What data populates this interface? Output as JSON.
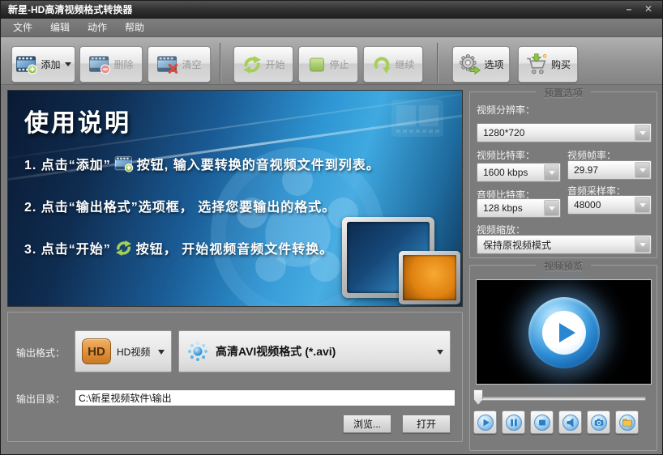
{
  "titlebar": {
    "title": "新星-HD高清视频格式转换器",
    "minimize_icon": "–",
    "close_icon": "✕"
  },
  "menubar": {
    "items": [
      "文件",
      "编辑",
      "动作",
      "帮助"
    ]
  },
  "toolbar": {
    "add": "添加",
    "delete": "删除",
    "clear": "清空",
    "start": "开始",
    "stop": "停止",
    "resume": "继续",
    "options": "选项",
    "buy": "购买"
  },
  "instructions": {
    "title": "使用说明",
    "line1_pre": "1. 点击“添加”",
    "line1_post": "按钮, 输入要转换的音视频文件到列表。",
    "line2": "2. 点击“输出格式”选项框， 选择您要输出的格式。",
    "line3_pre": "3. 点击“开始”",
    "line3_post": "按钮， 开始视频音频文件转换。"
  },
  "presets": {
    "header": "预置选项",
    "resolution_label": "视频分辨率：",
    "resolution_value": "1280*720",
    "video_bitrate_label": "视频比特率：",
    "video_bitrate_value": "1600 kbps",
    "framerate_label": "视频帧率：",
    "framerate_value": "29.97",
    "audio_bitrate_label": "音频比特率：",
    "audio_bitrate_value": "128 kbps",
    "sample_rate_label": "音频采样率：",
    "sample_rate_value": "48000",
    "scale_label": "视频缩放：",
    "scale_value": "保持原视频模式"
  },
  "preview": {
    "header": "视频预览"
  },
  "output": {
    "format_label": "输出格式：",
    "format_category_badge": "HD",
    "format_category_value": "HD视频",
    "format_value": "高清AVI视频格式 (*.avi)",
    "dir_label": "输出目录：",
    "dir_value": "C:\\新星视频软件\\输出",
    "browse_button": "浏览...",
    "open_button": "打开"
  },
  "colors": {
    "accent_blue": "#2e96d3",
    "hd_orange": "#dd8c35",
    "action_green": "#a5cf55"
  }
}
